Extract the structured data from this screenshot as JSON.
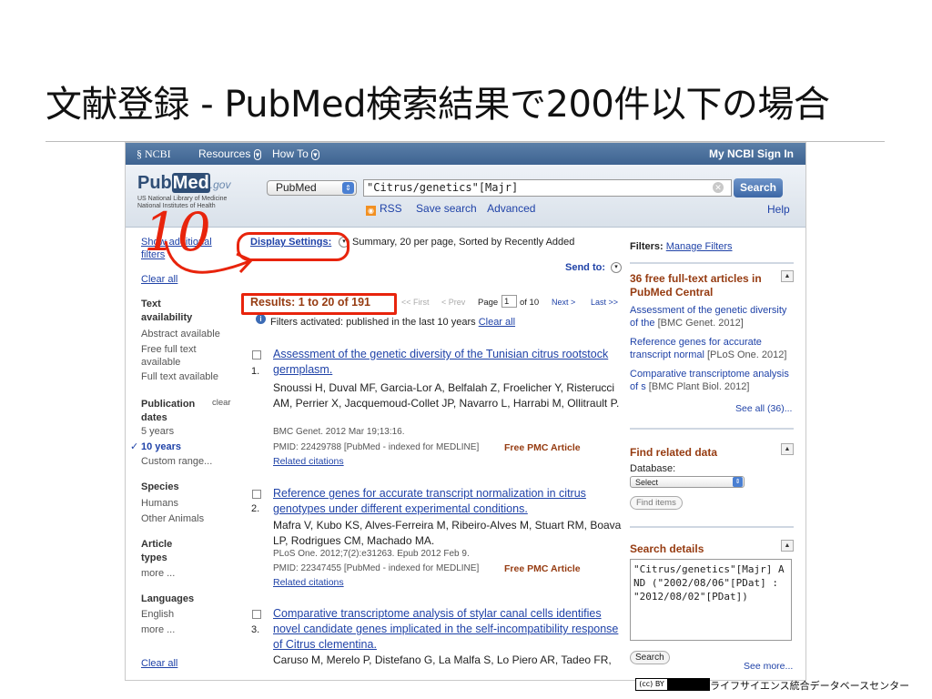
{
  "slide": {
    "title": "文献登録 - PubMed検索結果で200件以下の場合",
    "footer_license": "(cc) BY",
    "footer_org": "ライフサイエンス統合データベースセンター"
  },
  "ncbi_bar": {
    "logo": "NCBI",
    "resources": "Resources",
    "howto": "How To",
    "my_ncbi": "My NCBI",
    "sign_in": "Sign In"
  },
  "header": {
    "logo_pub": "Pub",
    "logo_med": "Med",
    "logo_gov": ".gov",
    "logo_sub1": "US National Library of Medicine",
    "logo_sub2": "National Institutes of Health",
    "db_value": "PubMed",
    "query": "\"Citrus/genetics\"[Majr]",
    "search_label": "Search",
    "rss": "RSS",
    "save_search": "Save search",
    "advanced": "Advanced",
    "help": "Help"
  },
  "left": {
    "show_filters": "Show additional filters",
    "clear_all_top": "Clear all",
    "text_avail_h": "Text availability",
    "abstract": "Abstract available",
    "free_full": "Free full text available",
    "full_text": "Full text available",
    "pub_dates_h": "Publication dates",
    "clear": "clear",
    "y5": "5 years",
    "y10": "10 years",
    "custom": "Custom range...",
    "species_h": "Species",
    "humans": "Humans",
    "other_animals": "Other Animals",
    "article_types_h": "Article types",
    "more1": "more ...",
    "languages_h": "Languages",
    "english": "English",
    "more2": "more ...",
    "clear_all_bottom": "Clear all"
  },
  "main": {
    "display_settings": "Display Settings:",
    "display_value": "Summary, 20 per page, Sorted by Recently Added",
    "send_to": "Send to:",
    "results": "Results: 1 to 20 of 191",
    "first": "<< First",
    "prev": "< Prev",
    "page_label": "Page",
    "page_value": "1",
    "of_pages": "of 10",
    "next": "Next >",
    "last": "Last >>",
    "filters_note": "Filters activated: published in the last 10 years",
    "filters_clear": "Clear all",
    "results_list": [
      {
        "num": "1.",
        "title": "Assessment of the genetic diversity of the Tunisian citrus rootstock germplasm.",
        "authors": "Snoussi H, Duval MF, Garcia-Lor A, Belfalah Z, Froelicher Y, Risterucci AM, Perrier X, Jacquemoud-Collet JP, Navarro L, Harrabi M, Ollitrault P.",
        "citation": "BMC Genet. 2012 Mar 19;13:16.",
        "pmid": "PMID: 22429788 [PubMed - indexed for MEDLINE]",
        "free": "Free PMC Article",
        "related": "Related citations"
      },
      {
        "num": "2.",
        "title": "Reference genes for accurate transcript normalization in citrus genotypes under different experimental conditions.",
        "authors": "Mafra V, Kubo KS, Alves-Ferreira M, Ribeiro-Alves M, Stuart RM, Boava LP, Rodrigues CM, Machado MA.",
        "citation": "PLoS One. 2012;7(2):e31263. Epub 2012 Feb 9.",
        "pmid": "PMID: 22347455 [PubMed - indexed for MEDLINE]",
        "free": "Free PMC Article",
        "related": "Related citations"
      },
      {
        "num": "3.",
        "title": "Comparative transcriptome analysis of stylar canal cells identifies novel candidate genes implicated in the self-incompatibility response of Citrus clementina.",
        "authors": "Caruso M, Merelo P, Distefano G, La Malfa S, Lo Piero AR, Tadeo FR,"
      }
    ]
  },
  "right": {
    "filters_label": "Filters:",
    "manage_filters": "Manage Filters",
    "free_title": "36 free full-text articles in PubMed Central",
    "pmc_items": [
      {
        "title": "Assessment of the genetic diversity of the",
        "src": "[BMC Genet. 2012]"
      },
      {
        "title": "Reference genes for accurate transcript normal",
        "src": "[PLoS One. 2012]"
      },
      {
        "title": "Comparative transcriptome analysis of s",
        "src": "[BMC Plant Biol. 2012]"
      }
    ],
    "see_all": "See all (36)...",
    "find_related_title": "Find related data",
    "database_label": "Database:",
    "database_value": "Select",
    "find_items": "Find items",
    "search_details_title": "Search details",
    "search_details_text": "\"Citrus/genetics\"[Majr] AND (\"2002/08/06\"[PDat] : \"2012/08/02\"[PDat])",
    "search_btn": "Search",
    "see_more": "See more..."
  },
  "annotation": {
    "handwritten": "10"
  },
  "colors": {
    "ncbi_bar": "#3e6391",
    "link": "#2043a8",
    "accent_brown": "#963c12",
    "annotation_red": "#e8240c"
  }
}
